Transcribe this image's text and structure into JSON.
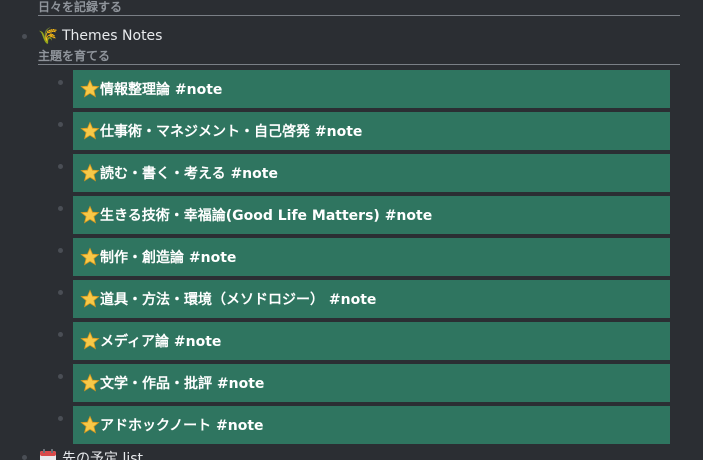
{
  "top_subheading": "日々を記録する",
  "themes_section": {
    "icon": "sheaf-of-rice-icon",
    "title": "Themes Notes",
    "subheading": "主題を育てる"
  },
  "notes": [
    {
      "label": "情報整理論 #note",
      "icon": "star-icon"
    },
    {
      "label": "仕事術・マネジメント・自己啓発 #note",
      "icon": "star-icon"
    },
    {
      "label": "読む・書く・考える #note",
      "icon": "star-icon"
    },
    {
      "label": "生きる技術・幸福論(Good Life Matters) #note",
      "icon": "star-icon"
    },
    {
      "label": "制作・創造論 #note",
      "icon": "star-icon"
    },
    {
      "label": "道具・方法・環境（メソドロジー） #note",
      "icon": "star-icon"
    },
    {
      "label": "メディア論 #note",
      "icon": "star-icon"
    },
    {
      "label": "文学・作品・批評 #note",
      "icon": "star-icon"
    },
    {
      "label": "アドホックノート #note",
      "icon": "star-icon"
    }
  ],
  "next_section": {
    "icon": "calendar-icon",
    "title": "先の予定 list"
  },
  "colors": {
    "background": "#2b2e33",
    "note_card": "#2f7560",
    "subheading_text": "#8f949b"
  }
}
